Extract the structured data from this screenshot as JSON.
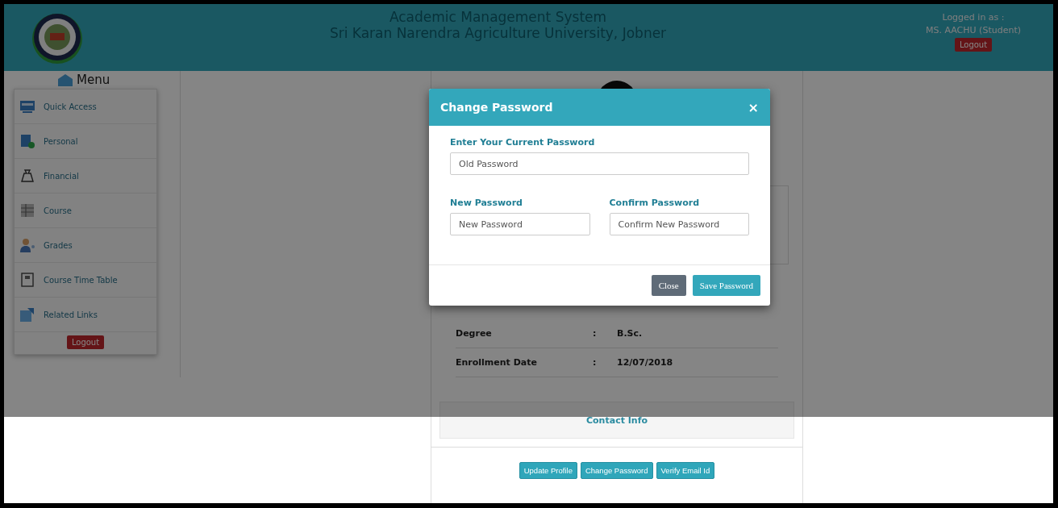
{
  "header": {
    "title": "Academic Management System",
    "subtitle": "Sri Karan Narendra Agriculture University, Jobner",
    "user_label": "Logged in as :",
    "user_name": "MS. AACHU (Student)",
    "logout": "Logout"
  },
  "sidebar": {
    "title": "Menu",
    "items": [
      {
        "label": "Quick Access",
        "kind": "monitor"
      },
      {
        "label": "Personal",
        "kind": "person"
      },
      {
        "label": "Financial",
        "kind": "bag"
      },
      {
        "label": "Course",
        "kind": "grid"
      },
      {
        "label": "Grades",
        "kind": "user"
      },
      {
        "label": "Course Time Table",
        "kind": "calendar"
      },
      {
        "label": "Related Links",
        "kind": "link"
      }
    ],
    "logout": "Logout"
  },
  "profile": {
    "rows": [
      {
        "label": "Degree",
        "separator": ":",
        "value": "B.Sc."
      },
      {
        "label": "Enrollment Date",
        "separator": ":",
        "value": "12/07/2018"
      }
    ],
    "contact_title": "Contact Info",
    "buttons": [
      "Update Profile",
      "Change Password",
      "Verify Email Id"
    ]
  },
  "modal": {
    "title": "Change Password",
    "close_icon": "×",
    "current_label": "Enter Your Current Password",
    "current_placeholder": "Old Password",
    "new_label": "New Password",
    "new_placeholder": "New Password",
    "confirm_label": "Confirm Password",
    "confirm_placeholder": "Confirm New Password",
    "buttons": [
      {
        "label": "Close",
        "kind": "secondary"
      },
      {
        "label": "Save Password",
        "kind": "primary"
      }
    ]
  }
}
